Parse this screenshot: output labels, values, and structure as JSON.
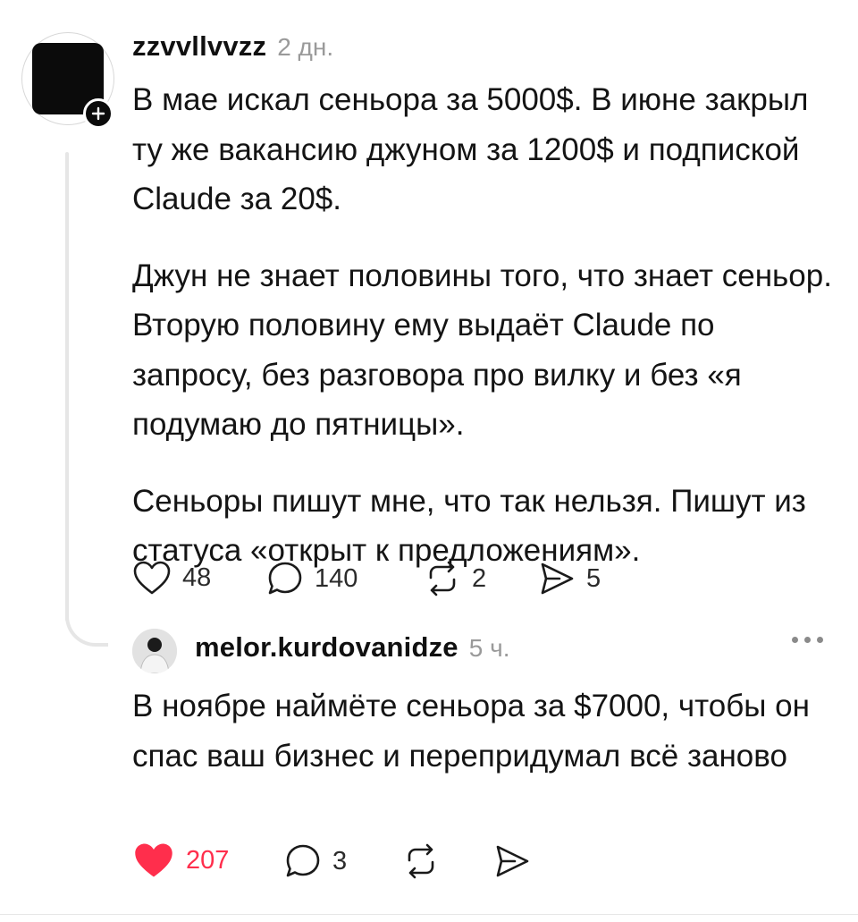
{
  "post": {
    "username": "zzvvllvvzz",
    "time": "2 дн.",
    "paragraphs": [
      "В мае искал сеньора за 5000$. В июне закрыл ту же вакансию джуном за 1200$ и подпиской Claude за 20$.",
      "Джун не знает половины того, что знает сеньор. Вторую половину ему выдаёт Claude по запросу, без разговора про вилку и без «я подумаю до пятницы».",
      "Сеньоры пишут мне, что так нельзя. Пишут из статуса «открыт к предложениям»."
    ],
    "actions": {
      "likes": "48",
      "comments": "140",
      "reposts": "2",
      "shares": "5"
    }
  },
  "reply": {
    "username": "melor.kurdovanidze",
    "time": "5 ч.",
    "text": "В ноябре наймёте сеньора за $7000, чтобы он спас ваш бизнес и перепридумал всё заново",
    "actions": {
      "likes": "207",
      "comments": "3"
    }
  },
  "icons": {
    "like": "heart-outline-icon",
    "liked": "heart-filled-icon",
    "comment": "speech-bubble-icon",
    "repost": "repost-arrows-icon",
    "share": "send-icon",
    "follow": "plus-icon",
    "more": "more-dots-icon"
  },
  "colors": {
    "liked_heart": "#ff2e4c",
    "text": "#141414",
    "secondary": "#9a9a9a"
  }
}
